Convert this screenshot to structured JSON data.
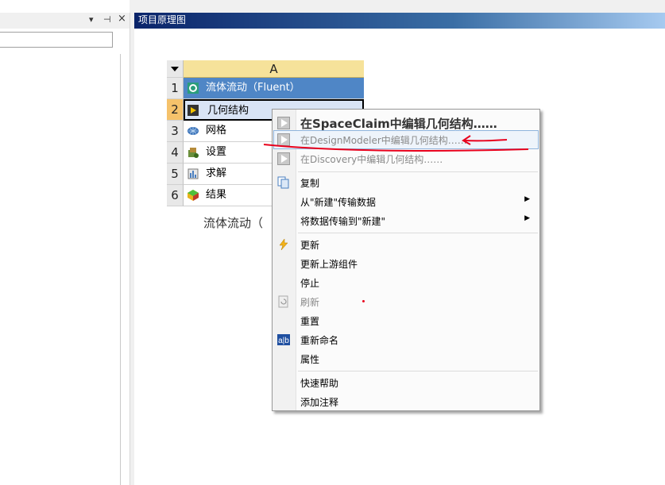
{
  "left_panel": {
    "dropdown_glyph": "▾",
    "pin_glyph": "⊣",
    "close_glyph": "×"
  },
  "schematic": {
    "title": "项目原理图",
    "column_header": "A",
    "rows": [
      {
        "num": "1",
        "label": "流体流动（Fluent）",
        "icon": "fluent-icon"
      },
      {
        "num": "2",
        "label": "几何结构",
        "icon": "geometry-icon"
      },
      {
        "num": "3",
        "label": "网格",
        "icon": "mesh-icon"
      },
      {
        "num": "4",
        "label": "设置",
        "icon": "setup-icon"
      },
      {
        "num": "5",
        "label": "求解",
        "icon": "solution-icon"
      },
      {
        "num": "6",
        "label": "结果",
        "icon": "results-icon"
      }
    ],
    "caption": "流体流动（"
  },
  "context_menu": {
    "edit_spaceclaim": "在SpaceClaim中编辑几何结构……",
    "edit_designmodeler": "在DesignModeler中编辑几何结构……",
    "edit_discovery": "在Discovery中编辑几何结构……",
    "copy": "复制",
    "transfer_from_new": "从\"新建\"传输数据",
    "transfer_to_new": "将数据传输到\"新建\"",
    "update": "更新",
    "update_upstream": "更新上游组件",
    "stop": "停止",
    "refresh": "刷新",
    "reset": "重置",
    "rename": "重新命名",
    "properties": "属性",
    "quick_help": "快速帮助",
    "add_note": "添加注释"
  },
  "colors": {
    "annotation": "#e8001c",
    "selected_row": "#4f86c6",
    "header": "#f6e29a"
  }
}
